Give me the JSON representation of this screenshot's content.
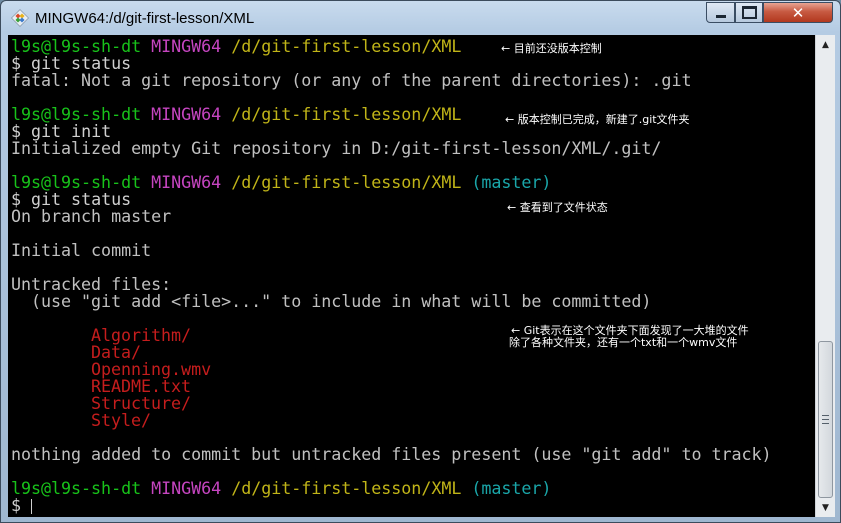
{
  "window": {
    "title": "MINGW64:/d/git-first-lesson/XML",
    "close_glyph": "✕"
  },
  "icons": {
    "app": "git-bash-icon",
    "minimize": "minimize-icon",
    "maximize": "maximize-icon",
    "close": "close-icon",
    "scroll_up": "scroll-up-arrow-icon",
    "scroll_down": "scroll-down-arrow-icon"
  },
  "colors": {
    "prompt_user": "#18c21a",
    "prompt_env": "#c545c0",
    "prompt_path": "#c0b418",
    "branch": "#1aa6a9",
    "untracked": "#c51d1d",
    "text": "#c0c0c0",
    "background": "#000000"
  },
  "prompt": {
    "user_host": "l9s@l9s-sh-dt",
    "env": "MINGW64",
    "path": "/d/git-first-lesson/XML",
    "branch": "(master)",
    "symbol": "$"
  },
  "terminal": {
    "cmd_status_1": "git status",
    "out_fatal": "fatal: Not a git repository (or any of the parent directories): .git",
    "cmd_init": "git init",
    "out_init": "Initialized empty Git repository in D:/git-first-lesson/XML/.git/",
    "cmd_status_2": "git status",
    "out_branch": "On branch master",
    "out_initial_commit": "Initial commit",
    "out_untracked_header": "Untracked files:",
    "out_untracked_hint": "  (use \"git add <file>...\" to include in what will be committed)",
    "untracked_files": [
      "Algorithm/",
      "Data/",
      "Openning.wmv",
      "README.txt",
      "Structure/",
      "Style/"
    ],
    "out_nothing_added": "nothing added to commit but untracked files present (use \"git add\" to track)"
  },
  "annotations": {
    "note1": "← 目前还没版本控制",
    "note2": "← 版本控制已完成，新建了.git文件夹",
    "note3": "← 查看到了文件状态",
    "note4_line1": "← Git表示在这个文件夹下面发现了一大堆的文件",
    "note4_line2": "除了各种文件夹，还有一个txt和一个wmv文件"
  }
}
